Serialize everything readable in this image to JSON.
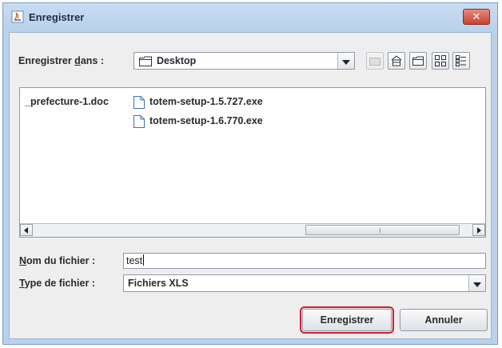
{
  "window": {
    "title": "Enregistrer",
    "close_glyph": "✕"
  },
  "save_in": {
    "label_pre": "Enregistrer ",
    "label_mnemonic": "d",
    "label_post": "ans :",
    "value": "Desktop"
  },
  "files": [
    {
      "name": "_prefecture-1.doc",
      "icon": "none"
    },
    {
      "name": "totem-setup-1.5.727.exe",
      "icon": "file-icon"
    },
    {
      "name": "totem-setup-1.6.770.exe",
      "icon": "file-icon"
    }
  ],
  "filename": {
    "label_mnemonic": "N",
    "label_rest": "om du fichier :",
    "value": "test"
  },
  "filetype": {
    "label_mnemonic": "T",
    "label_rest": "ype de fichier :",
    "value": "Fichiers XLS"
  },
  "buttons": {
    "save": "Enregistrer",
    "cancel": "Annuler"
  },
  "colors": {
    "highlight": "#d0202a",
    "titlebar": "#b9d1ea"
  }
}
